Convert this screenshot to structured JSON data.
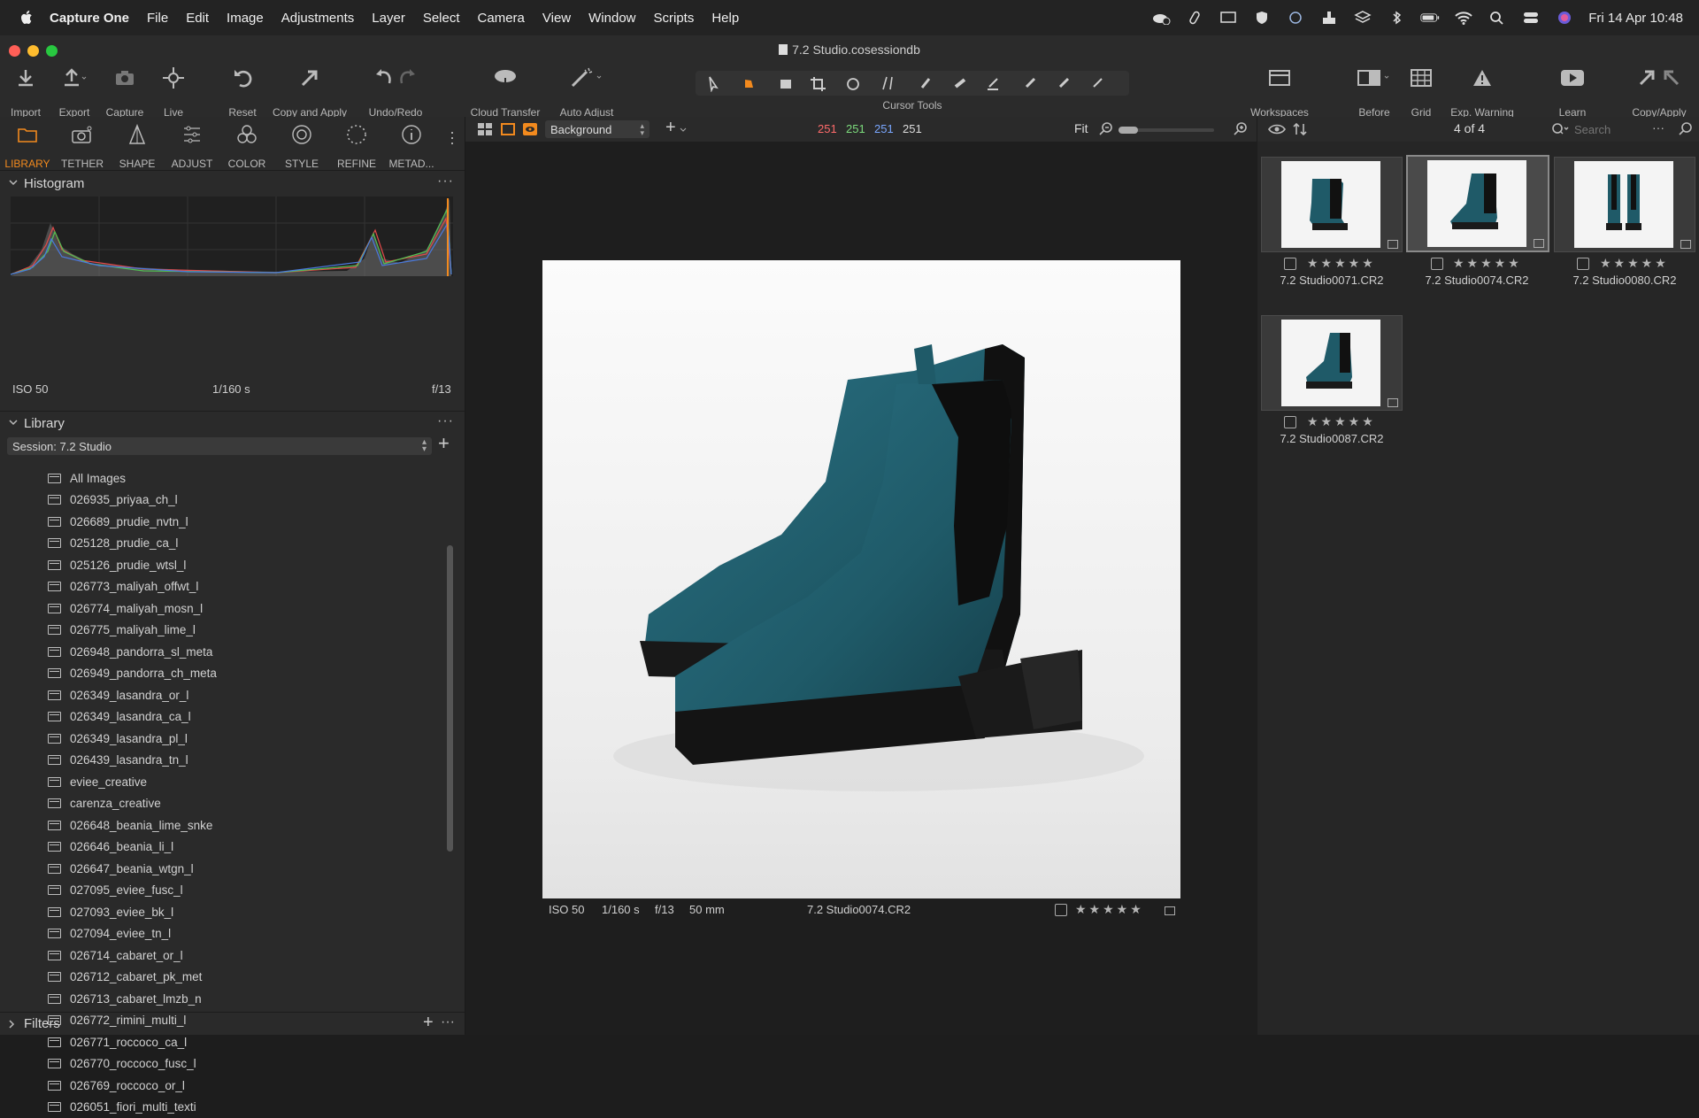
{
  "menubar": {
    "app": "Capture One",
    "items": [
      "File",
      "Edit",
      "Image",
      "Adjustments",
      "Layer",
      "Select",
      "Camera",
      "View",
      "Window",
      "Scripts",
      "Help"
    ],
    "clock": "Fri 14 Apr  10:48"
  },
  "window": {
    "title": "7.2 Studio.cosessiondb"
  },
  "toolbar": {
    "import": "Import",
    "export": "Export",
    "capture": "Capture",
    "live": "Live",
    "reset": "Reset",
    "copy_apply": "Copy and Apply",
    "undo_redo": "Undo/Redo",
    "cloud_transfer": "Cloud Transfer",
    "auto_adjust": "Auto Adjust",
    "cursor_tools": "Cursor Tools",
    "workspaces": "Workspaces",
    "before": "Before",
    "grid": "Grid",
    "exp_warning": "Exp. Warning",
    "learn": "Learn",
    "copy_apply2": "Copy/Apply"
  },
  "tool_tabs": [
    "LIBRARY",
    "TETHER",
    "SHAPE",
    "ADJUST",
    "COLOR",
    "STYLE",
    "REFINE",
    "METAD..."
  ],
  "histogram": {
    "title": "Histogram",
    "iso": "ISO 50",
    "shutter": "1/160 s",
    "aperture": "f/13"
  },
  "library": {
    "title": "Library",
    "session": "Session: 7.2 Studio",
    "all_images": "All Images",
    "items": [
      "026935_priyaa_ch_l",
      "026689_prudie_nvtn_l",
      "025128_prudie_ca_l",
      "025126_prudie_wtsl_l",
      "026773_maliyah_offwt_l",
      "026774_maliyah_mosn_l",
      "026775_maliyah_lime_l",
      "026948_pandorra_sl_meta",
      "026949_pandorra_ch_meta",
      "026349_lasandra_or_l",
      "026349_lasandra_ca_l",
      "026349_lasandra_pl_l",
      "026439_lasandra_tn_l",
      "eviee_creative",
      "carenza_creative",
      "026648_beania_lime_snke",
      "026646_beania_li_l",
      "026647_beania_wtgn_l",
      "027095_eviee_fusc_l",
      "027093_eviee_bk_l",
      "027094_eviee_tn_l",
      "026714_cabaret_or_l",
      "026712_cabaret_pk_met",
      "026713_cabaret_lmzb_n",
      "026772_rimini_multi_l",
      "026771_roccoco_ca_l",
      "026770_roccoco_fusc_l",
      "026769_roccoco_or_l",
      "026051_fiori_multi_texti"
    ]
  },
  "filters": {
    "title": "Filters"
  },
  "viewer": {
    "background_select": "Background",
    "rgb": {
      "r": "251",
      "g": "251",
      "b": "251",
      "l": "251"
    },
    "zoom": "Fit",
    "meta": {
      "iso": "ISO 50",
      "shutter": "1/160 s",
      "aperture": "f/13",
      "focal": "50 mm",
      "filename": "7.2 Studio0074.CR2"
    },
    "stars": "★★★★★"
  },
  "browser": {
    "count": "4 of 4",
    "search_placeholder": "Search",
    "thumbs": [
      {
        "name": "7.2 Studio0071.CR2",
        "stars": "★★★★★"
      },
      {
        "name": "7.2 Studio0074.CR2",
        "stars": "★★★★★"
      },
      {
        "name": "7.2 Studio0080.CR2",
        "stars": "★★★★★"
      },
      {
        "name": "7.2 Studio0087.CR2",
        "stars": "★★★★★"
      }
    ]
  },
  "colors": {
    "accent": "#f28a1e",
    "r": "#ff6b6b",
    "g": "#7ddc7d",
    "b": "#7aa7ff",
    "boot": "#1f5a68"
  }
}
